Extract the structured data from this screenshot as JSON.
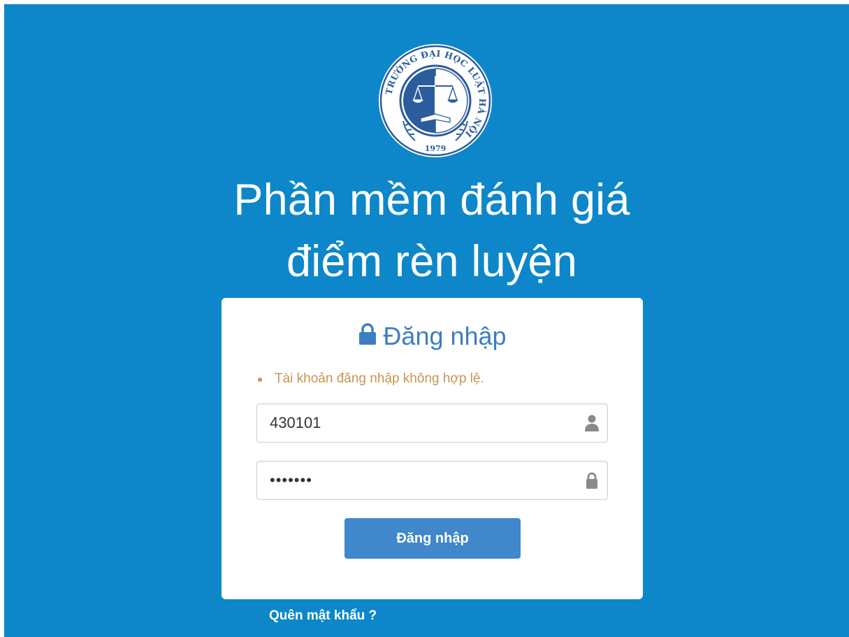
{
  "logo": {
    "icon": "hanoi-law-university-seal",
    "ring_text": "TRƯỜNG ĐẠI HỌC LUẬT HÀ NỘI",
    "year": "1979"
  },
  "header": {
    "title_line1": "Phần mềm đánh giá",
    "title_line2": "điểm rèn luyện"
  },
  "login": {
    "title": "Đăng nhập",
    "title_icon": "lock-icon",
    "errors": [
      "Tài khoản đăng nhập không hợp lệ."
    ],
    "username": {
      "value": "430101",
      "icon": "user-icon"
    },
    "password": {
      "value": "1234567",
      "icon": "lock-icon"
    },
    "submit_label": "Đăng nhập"
  },
  "forgot_password_label": "Quên mật khẩu ?",
  "colors": {
    "background": "#0d87c9",
    "card": "#ffffff",
    "title_blue": "#3d7ec1",
    "button": "#4087cc",
    "error": "#c6954f",
    "seal_blue": "#2b5c9e"
  }
}
